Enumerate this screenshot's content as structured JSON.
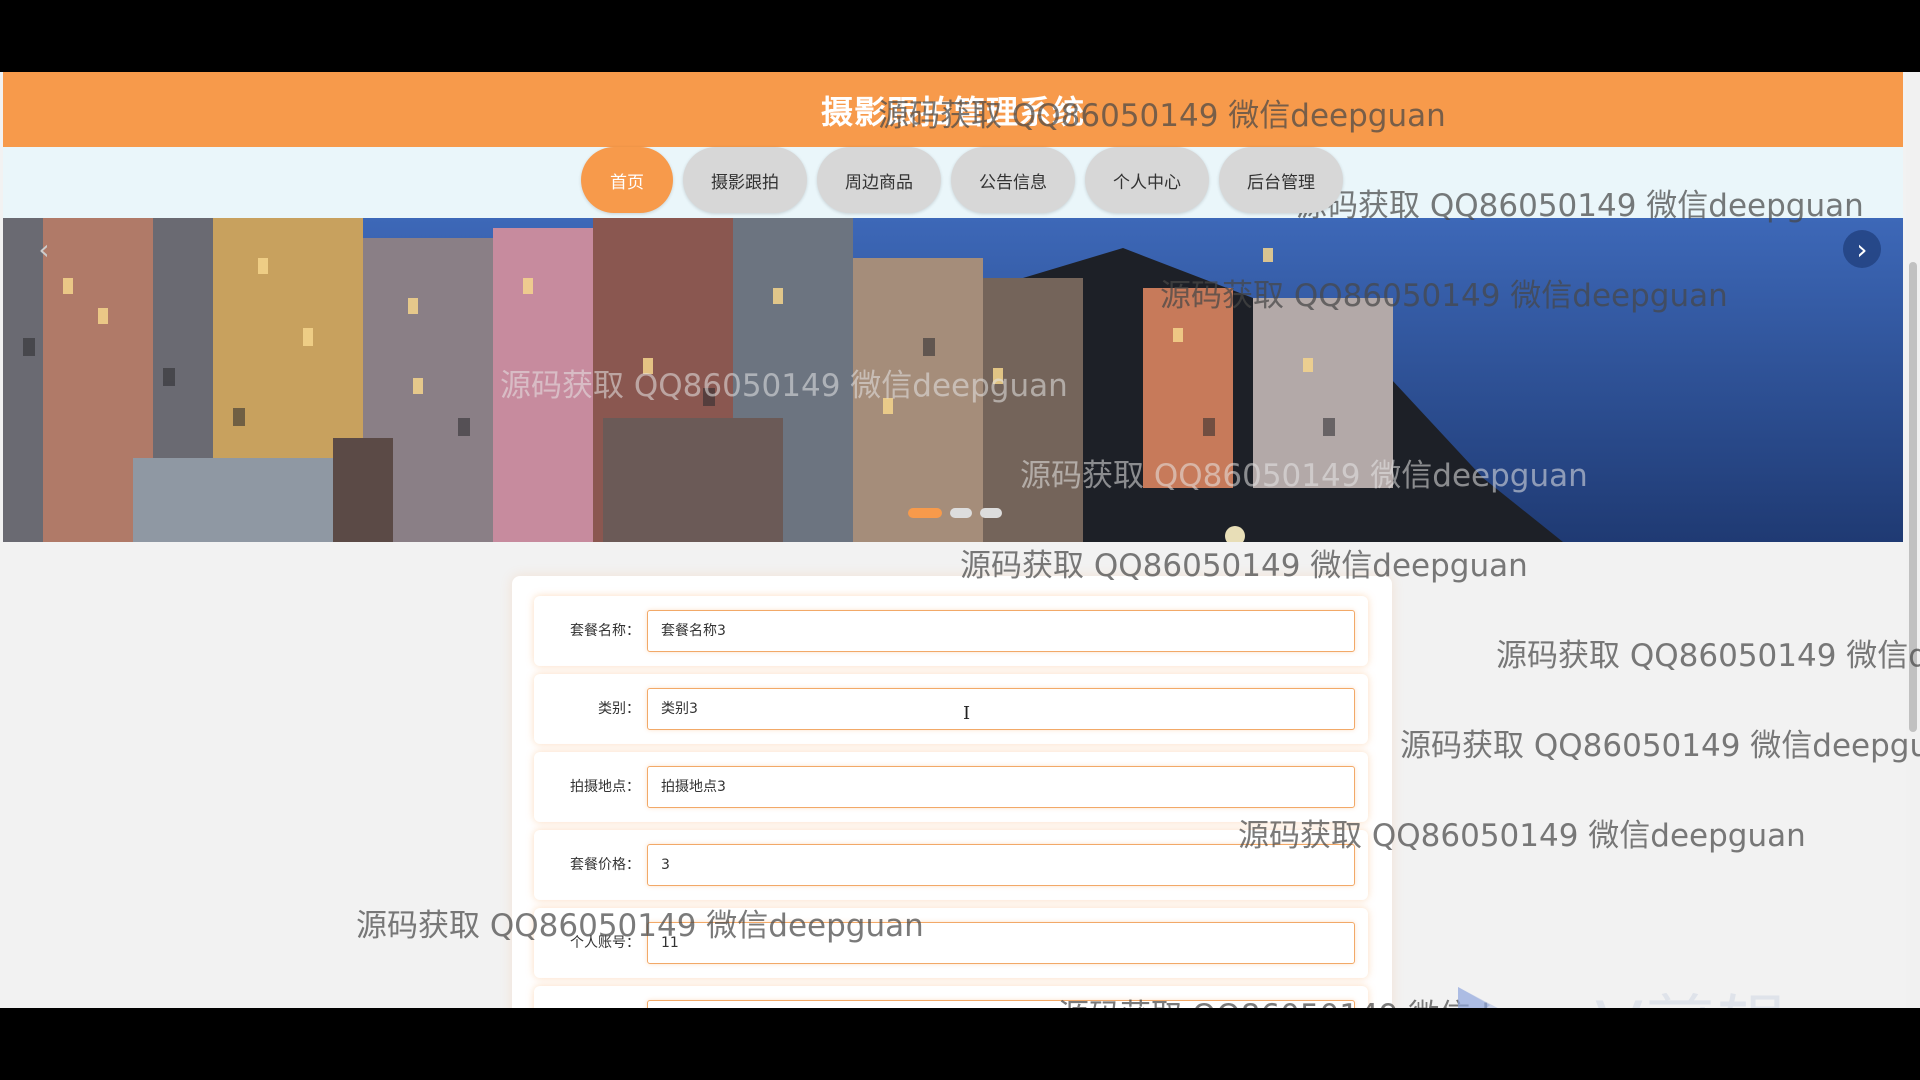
{
  "site": {
    "title": "摄影跟拍管理系统"
  },
  "nav": {
    "items": [
      {
        "label": "首页",
        "active": true
      },
      {
        "label": "摄影跟拍",
        "active": false
      },
      {
        "label": "周边商品",
        "active": false
      },
      {
        "label": "公告信息",
        "active": false
      },
      {
        "label": "个人中心",
        "active": false
      },
      {
        "label": "后台管理",
        "active": false
      }
    ]
  },
  "carousel": {
    "prev": "‹",
    "next": "›",
    "slide_count": 3,
    "active_index": 0
  },
  "form": {
    "fields": [
      {
        "label": "套餐名称：",
        "value": "套餐名称3"
      },
      {
        "label": "类别：",
        "value": "类别3"
      },
      {
        "label": "拍摄地点：",
        "value": "拍摄地点3"
      },
      {
        "label": "套餐价格：",
        "value": "3"
      },
      {
        "label": "个人账号：",
        "value": "11"
      }
    ]
  },
  "watermark": {
    "text": "源码获取 QQ86050149 微信deepguan"
  },
  "overlay": {
    "brand": "eV剪辑"
  },
  "colors": {
    "accent": "#f79a4b",
    "nav_bg": "#eaf6fa",
    "page_bg": "#f2f2f2"
  }
}
